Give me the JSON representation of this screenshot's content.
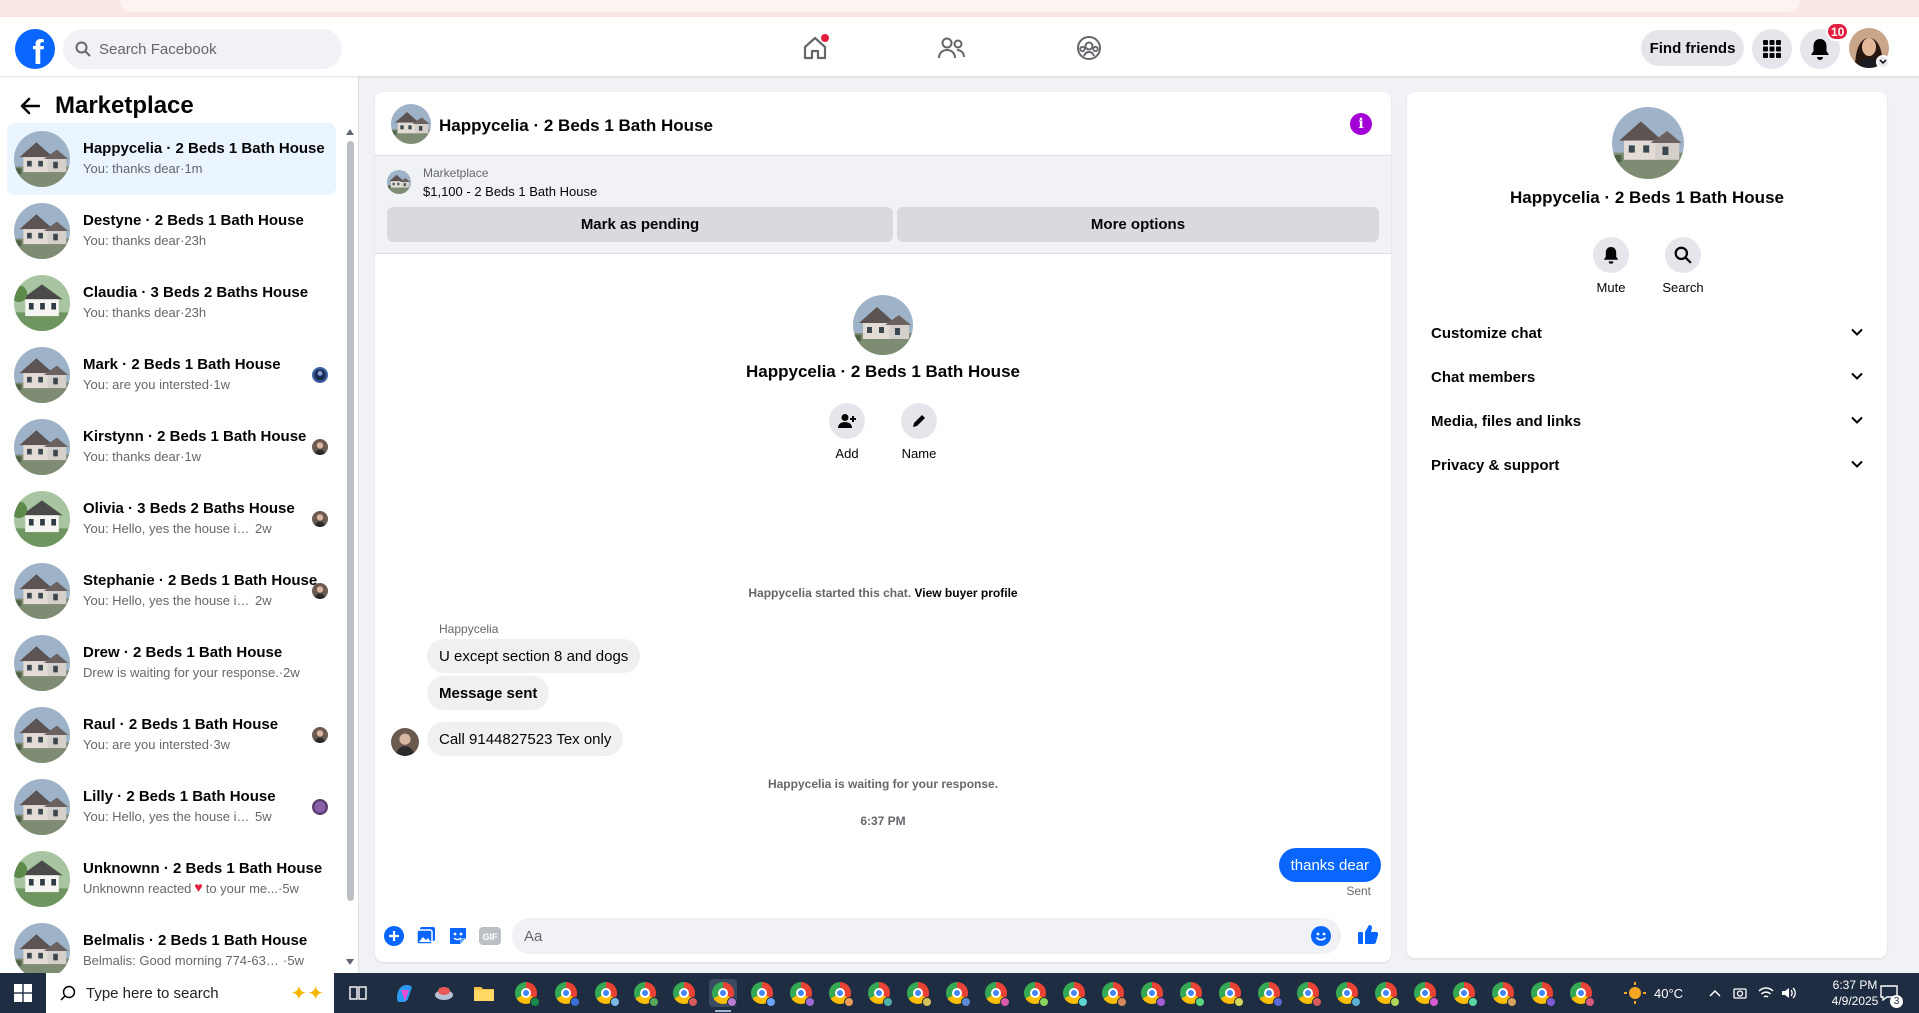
{
  "topbar": {
    "search_placeholder": "Search Facebook",
    "find_friends_label": "Find friends",
    "notification_count": "10"
  },
  "left_panel": {
    "title": "Marketplace",
    "conversations": [
      {
        "title": "Happycelia · 2 Beds 1 Bath House",
        "snippet": "You: thanks dear",
        "time": "1m",
        "active": true
      },
      {
        "title": "Destyne · 2 Beds 1 Bath House",
        "snippet": "You: thanks dear",
        "time": "23h"
      },
      {
        "title": "Claudia · 3 Beds 2 Baths House",
        "snippet": "You: thanks dear",
        "time": "23h"
      },
      {
        "title": "Mark · 2 Beds 1 Bath House",
        "snippet": "You: are you intersted",
        "time": "1w"
      },
      {
        "title": "Kirstynn · 2 Beds 1 Bath House",
        "snippet": "You: thanks dear",
        "time": "1w"
      },
      {
        "title": "Olivia · 3 Beds 2 Baths House",
        "snippet": "You: Hello, yes the house is still ...",
        "time": "2w"
      },
      {
        "title": "Stephanie · 2 Beds 1 Bath House",
        "snippet": "You: Hello, yes the house is still ...",
        "time": "2w"
      },
      {
        "title": "Drew · 2 Beds 1 Bath House",
        "snippet": "Drew is waiting for your response.",
        "time": "2w"
      },
      {
        "title": "Raul · 2 Beds 1 Bath House",
        "snippet": "You: are you intersted",
        "time": "3w"
      },
      {
        "title": "Lilly · 2 Beds 1 Bath House",
        "snippet": "You: Hello, yes the house is still ...",
        "time": "5w"
      },
      {
        "title": "Unknownn · 2 Beds 1 Bath House",
        "snippet_before": "Unknownn reacted",
        "snippet_after": "to your me...",
        "time": "5w"
      },
      {
        "title": "Belmalis · 2 Beds 1 Bath House",
        "snippet": "Belmalis: Good morning 774-635-...",
        "time": "5w"
      }
    ]
  },
  "chat": {
    "title": "Happycelia · 2 Beds 1 Bath House",
    "marketplace_source": "Marketplace",
    "listing": "$1,100 - 2 Beds 1 Bath House",
    "mark_pending_label": "Mark as pending",
    "more_options_label": "More options",
    "intro_name": "Happycelia · 2 Beds 1 Bath House",
    "add_label": "Add",
    "name_label": "Name",
    "started_text": "Happycelia started this chat.",
    "view_profile_label": "View buyer profile",
    "sender_name": "Happycelia",
    "messages": [
      "U except section 8 and dogs",
      "Message sent",
      "Call 9144827523 Tex only"
    ],
    "waiting_text": "Happycelia is waiting for your response.",
    "timestamp": "6:37 PM",
    "my_message": "thanks dear",
    "my_status": "Sent",
    "composer_placeholder": "Aa"
  },
  "right_panel": {
    "name": "Happycelia · 2 Beds 1 Bath House",
    "mute_label": "Mute",
    "search_label": "Search",
    "sections": [
      "Customize chat",
      "Chat members",
      "Media, files and links",
      "Privacy & support"
    ]
  },
  "taskbar": {
    "search_placeholder": "Type here to search",
    "temperature": "40°C",
    "time": "6:37 PM",
    "date": "4/9/2025",
    "notification_count": "3"
  },
  "colors": {
    "brand": "#0866ff",
    "messenger_accent": "#a200d6",
    "active_conv_bg": "#ebf5ff",
    "taskbar_bg": "#1f2d42"
  }
}
